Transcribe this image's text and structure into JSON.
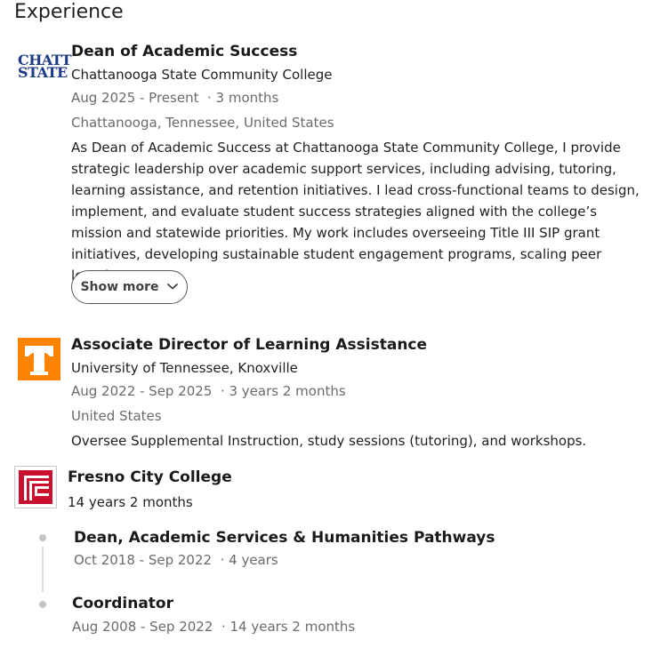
{
  "section": {
    "title": "Experience"
  },
  "experience": [
    {
      "logo": {
        "line1": "CHATT",
        "line2": "STATE",
        "color": "#1d3a8a"
      },
      "title": "Dean of Academic Success",
      "company": "Chattanooga State Community College",
      "dates": "Aug 2025 - Present",
      "duration": "· 3 months",
      "location": "Chattanooga, Tennessee, United States",
      "description": "As Dean of Academic Success at Chattanooga State Community College, I provide strategic leadership over academic support services, including advising, tutoring, learning assistance, and retention initiatives. I lead cross-functional teams to design, implement, and evaluate student success strategies aligned with the college’s mission and statewide priorities. My work includes overseeing Title III SIP grant initiatives, developing sustainable student engagement programs, scaling peer learning...",
      "show_more": "Show more"
    },
    {
      "logo": {
        "icon": "ut-power-t-logo",
        "color": "#ff8200"
      },
      "title": "Associate Director of Learning Assistance",
      "company": "University of Tennessee, Knoxville",
      "dates": "Aug 2022 - Sep 2025",
      "duration": "· 3 years 2 months",
      "location": "United States",
      "description": "Oversee Supplemental Instruction, study sessions (tutoring), and workshops."
    },
    {
      "logo": {
        "icon": "fresno-city-college-logo",
        "color": "#c8102e"
      },
      "company": "Fresno City College",
      "total_duration": "14 years 2 months",
      "roles": [
        {
          "title": "Dean, Academic Services & Humanities Pathways",
          "dates": "Oct 2018 - Sep 2022",
          "duration": "· 4 years"
        },
        {
          "title": "Coordinator",
          "dates": "Aug 2008 - Sep 2022",
          "duration": "· 14 years 2 months"
        }
      ]
    }
  ]
}
